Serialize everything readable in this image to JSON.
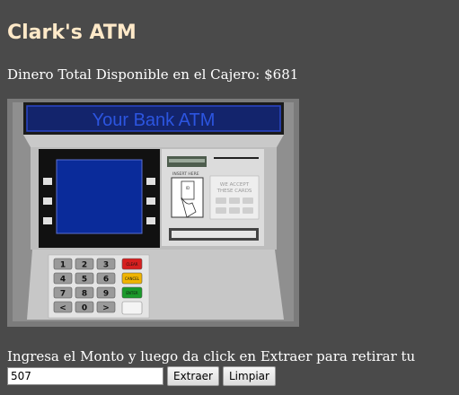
{
  "page": {
    "title": "Clark's ATM",
    "total_label": "Dinero Total Disponible en el Cajero: $681",
    "prompt": "Ingresa el Monto y luego da click en Extraer para retirar tu dinero:"
  },
  "atm": {
    "header_text": "Your Bank ATM",
    "insert_here": "INSERT HERE",
    "card_id_label": "ID",
    "accept_line1": "WE ACCEPT",
    "accept_line2": "THESE CARDS",
    "keypad": {
      "digits": [
        "1",
        "2",
        "3",
        "4",
        "5",
        "6",
        "7",
        "8",
        "9",
        "<",
        "0",
        ">"
      ],
      "side": [
        "CLEAR",
        "CANCEL",
        "ENTER"
      ]
    }
  },
  "form": {
    "amount_value": "507",
    "extract_label": "Extraer",
    "clear_label": "Limpiar"
  },
  "colors": {
    "background": "#4a4a4a",
    "title": "#ffe9c8",
    "screen": "#0a2b9a",
    "clear_key": "#d61f1f",
    "cancel_key": "#f0b400",
    "enter_key": "#1a9a2a"
  }
}
